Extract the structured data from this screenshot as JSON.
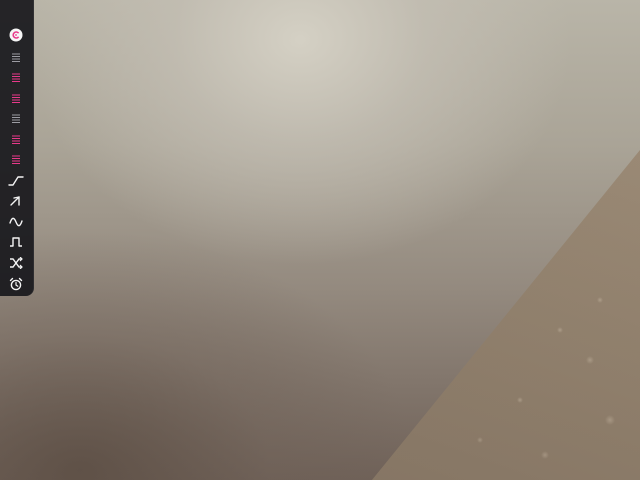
{
  "app": {
    "view": "camera-preview"
  },
  "colors": {
    "toolbar_bg": "#18181c",
    "accent": "#e8398a",
    "icon_white": "#f4f4f4",
    "icon_grey": "#9c9ca3",
    "avatar_bg": "#f6f6f6"
  },
  "toolbar": {
    "items": [
      {
        "icon": "avatar-icon",
        "selected": true
      },
      {
        "icon": "channel-strip-icon"
      },
      {
        "icon": "channel-strip-icon"
      },
      {
        "icon": "channel-strip-icon"
      },
      {
        "icon": "channel-strip-icon"
      },
      {
        "icon": "channel-strip-icon"
      },
      {
        "icon": "channel-strip-icon"
      },
      {
        "icon": "ramp-wave-icon"
      },
      {
        "icon": "sawtooth-wave-icon"
      },
      {
        "icon": "sine-wave-icon"
      },
      {
        "icon": "square-wave-icon"
      },
      {
        "icon": "shuffle-icon"
      },
      {
        "icon": "alarm-clock-icon"
      }
    ]
  }
}
